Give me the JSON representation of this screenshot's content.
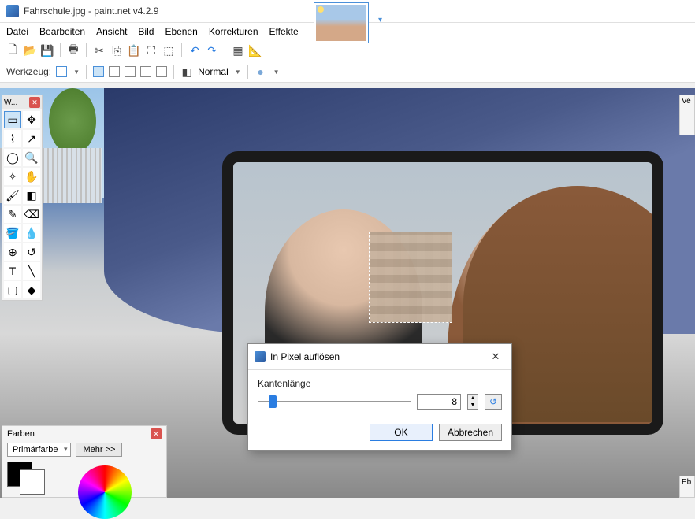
{
  "title": "Fahrschule.jpg - paint.net v4.2.9",
  "menu": {
    "file": "Datei",
    "edit": "Bearbeiten",
    "view": "Ansicht",
    "image": "Bild",
    "layers": "Ebenen",
    "adjust": "Korrekturen",
    "effects": "Effekte"
  },
  "toolbar2": {
    "label": "Werkzeug:",
    "blend_label": "Normal"
  },
  "tools_panel": {
    "title": "W..."
  },
  "colors_panel": {
    "title": "Farben",
    "primary": "Primärfarbe",
    "more": "Mehr >>"
  },
  "right_panel": {
    "title": "Ve"
  },
  "right_panel2": {
    "title": "Eb"
  },
  "dialog": {
    "title": "In Pixel auflösen",
    "edge_label": "Kantenlänge",
    "value": "8",
    "ok": "OK",
    "cancel": "Abbrechen"
  }
}
